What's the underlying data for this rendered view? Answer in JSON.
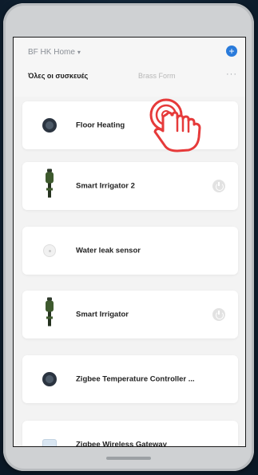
{
  "header": {
    "home_title": "BF HK Home",
    "chevron": "▾",
    "add_label": "+"
  },
  "tabs": {
    "active": "Όλες οι συσκευές",
    "inactive": "Brass Form",
    "more": "···"
  },
  "devices": [
    {
      "name": "Floor Heating",
      "icon": "thermostat-icon",
      "power": false
    },
    {
      "name": "Smart Irrigator 2",
      "icon": "irrigator-icon",
      "power": true
    },
    {
      "name": "Water leak sensor",
      "icon": "sensor-icon",
      "power": false
    },
    {
      "name": "Smart Irrigator",
      "icon": "irrigator-icon",
      "power": true
    },
    {
      "name": "Zigbee Temperature Controller ...",
      "icon": "thermostat-icon",
      "power": false
    },
    {
      "name": "Zigbee Wireless Gateway",
      "icon": "gateway-icon",
      "power": false
    }
  ],
  "colors": {
    "accent": "#2a7bdb",
    "tap_highlight": "#e63a3a",
    "card": "#ffffff",
    "screen_bg": "#f3f3f3"
  }
}
